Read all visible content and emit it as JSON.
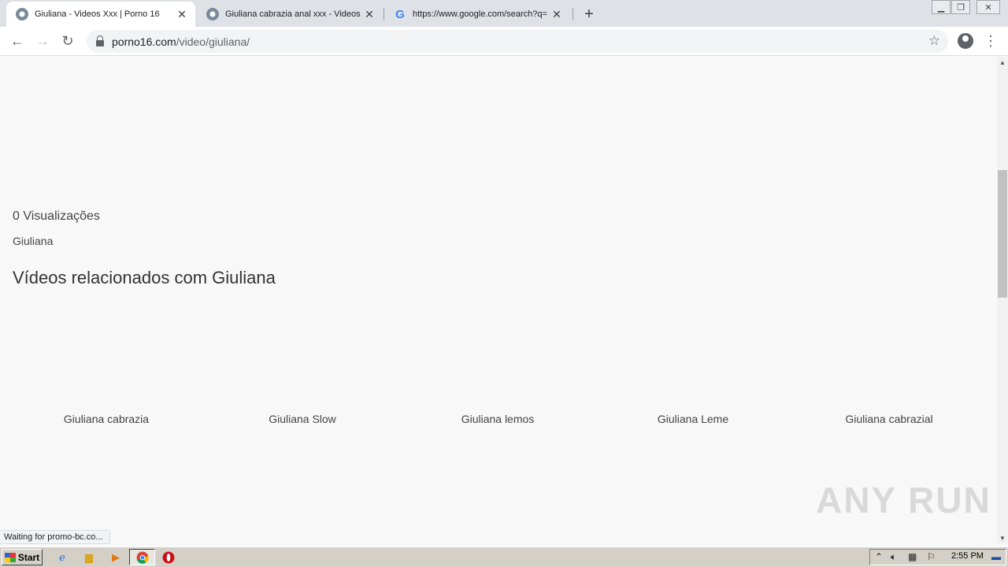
{
  "browser": {
    "tabs": [
      {
        "title": "Giuliana - Videos Xxx | Porno 16",
        "icon": "site-favicon",
        "active": true
      },
      {
        "title": "Giuliana cabrazia anal xxx - Videos X",
        "icon": "site-favicon",
        "active": false
      },
      {
        "title": "https://www.google.com/search?q=",
        "icon": "google-favicon",
        "active": false
      }
    ],
    "new_tab": "+",
    "close_glyph": "✕",
    "url_domain": "porno16.com",
    "url_path": "/video/giuliana/"
  },
  "page": {
    "views": "0 Visualizações",
    "tag": "Giuliana",
    "related_heading": "Vídeos relacionados com Giuliana",
    "related_videos": [
      "Giuliana cabrazia",
      "Giuliana Slow",
      "Giuliana lemos",
      "Giuliana Leme",
      "Giuliana cabrazial"
    ]
  },
  "status_bar": "Waiting for promo-bc.co...",
  "watermark": "ANY RUN",
  "taskbar": {
    "start_label": "Start",
    "clock": "2:55 PM"
  }
}
